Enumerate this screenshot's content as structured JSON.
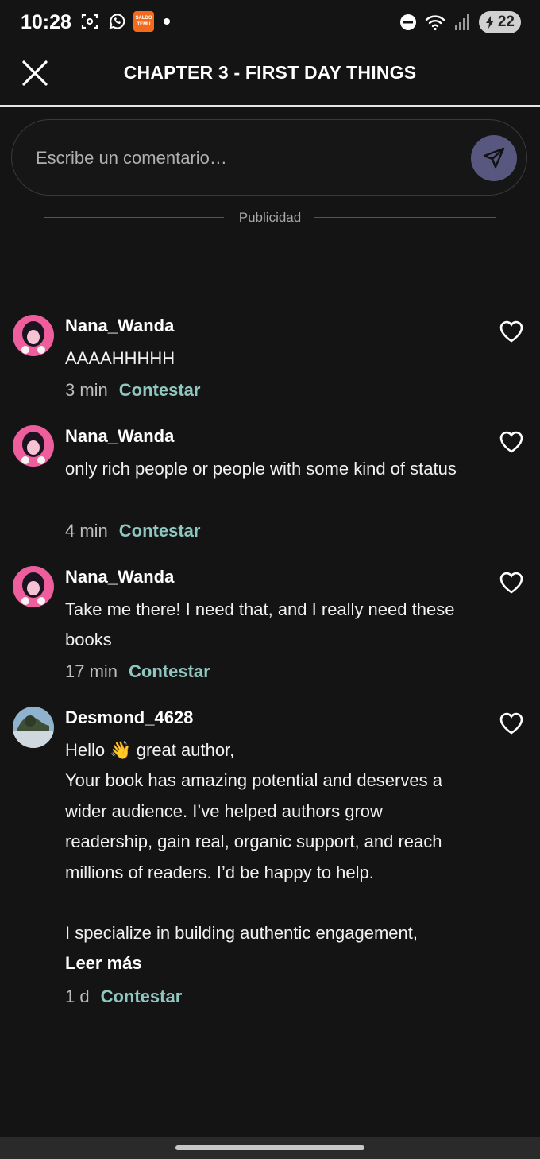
{
  "status_bar": {
    "time": "10:28",
    "left_icons": [
      "screenshot-icon",
      "whatsapp-icon",
      "temu-icon",
      "notification-dot"
    ],
    "temu_text": "SALDO TEMU",
    "right_icons": [
      "do-not-disturb-icon",
      "wifi-icon",
      "signal-icon"
    ],
    "battery": "22"
  },
  "header": {
    "title": "CHAPTER 3 - FIRST DAY THINGS",
    "close_icon": "close-icon"
  },
  "composer": {
    "placeholder": "Escribe un comentario…",
    "send_icon": "send-icon",
    "send_color": "#58577f"
  },
  "ad": {
    "label": "Publicidad"
  },
  "comments": [
    {
      "username": "Nana_Wanda",
      "text": "AAAAHHHHH",
      "time": "3 min",
      "reply": "Contestar"
    },
    {
      "username": "Nana_Wanda",
      "text": "only rich people or people with some kind of status",
      "time": "4 min",
      "reply": "Contestar"
    },
    {
      "username": "Nana_Wanda",
      "text": "Take me there! I need that, and I really need these books",
      "time": "17 min",
      "reply": "Contestar"
    },
    {
      "username": "Desmond_4628",
      "text": "Hello 👋 great author,\nYour book has amazing potential and deserves a wider audience. I’ve helped authors grow readership, gain real, organic support, and reach millions of readers. I’d be happy to help.\n\nI specialize in building authentic engagement,",
      "read_more": "Leer más",
      "time": "1 d",
      "reply": "Contestar"
    }
  ],
  "colors": {
    "background": "#141414",
    "reply_accent": "#8fc7c0",
    "text": "#ffffff"
  }
}
